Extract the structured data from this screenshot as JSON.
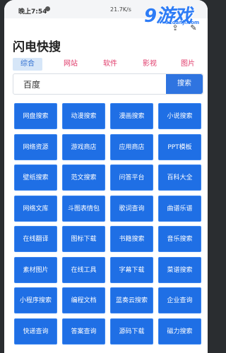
{
  "status": {
    "time": "晚上7:54",
    "network": "21.7K/s"
  },
  "watermark": {
    "big": "9游戏",
    "small": "91danji.com"
  },
  "app": {
    "title": "闪电快搜"
  },
  "tabs": [
    "综合",
    "网站",
    "软件",
    "影视",
    "图片"
  ],
  "search": {
    "value": "百度",
    "button": "搜索"
  },
  "grid": [
    [
      "网盘搜索",
      "动漫搜索",
      "漫画搜索",
      "小说搜索"
    ],
    [
      "网络资源",
      "游戏商店",
      "应用商店",
      "PPT模板"
    ],
    [
      "壁纸搜索",
      "范文搜索",
      "问答平台",
      "百科大全"
    ],
    [
      "网络文库",
      "斗图表情包",
      "歌词查询",
      "曲谱乐谱"
    ],
    [
      "在线翻译",
      "图标下载",
      "书籍搜索",
      "音乐搜索"
    ],
    [
      "素材图片",
      "在线工具",
      "字幕下载",
      "菜谱搜索"
    ],
    [
      "小程序搜索",
      "编程文档",
      "蓝奏云搜索",
      "企业查询"
    ],
    [
      "快递查询",
      "答案查询",
      "源码下载",
      "磁力搜索"
    ]
  ],
  "icons": {
    "notification": "bell-icon",
    "edit": "edit-icon"
  },
  "colors": {
    "primary": "#1f6fe5",
    "tab_text": "#e03a6a",
    "tab_active_bg": "#d6e6f8"
  }
}
